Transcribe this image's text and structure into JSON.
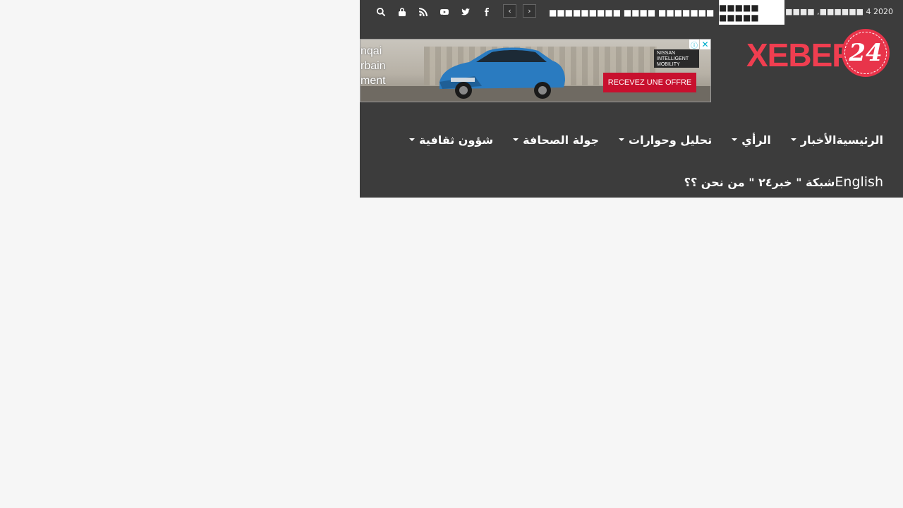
{
  "topbar": {
    "date": "2020 4 ■■■■■■, ■■■■■■",
    "breaking_label": "■■■■■ ■■■■■",
    "ticker_text": "■■■■■■■■■ ■■■■ ■■■■■■■■■■ ■■■■■■ ■...",
    "prev_symbol": "‹",
    "next_symbol": "›",
    "social_icons": [
      "search-icon",
      "lock-icon",
      "rss-icon",
      "youtube-icon",
      "twitter-icon",
      "facebook-icon"
    ]
  },
  "logo": {
    "text": "XEBER",
    "number": "24",
    "color": "#f03e50"
  },
  "ad": {
    "text_lines": [
      "nqai",
      "rbain",
      "ment"
    ],
    "brand_lines": [
      "NISSAN",
      "INTELLIGENT",
      "MOBILITY"
    ],
    "cta": "RECEVEZ UNE OFFRE",
    "info_symbol": "ⓘ",
    "close_symbol": "✕"
  },
  "nav": {
    "row1": [
      {
        "label": "الرئيسية",
        "dropdown": false
      },
      {
        "label": "الأخبار",
        "dropdown": true
      },
      {
        "label": "الرأي",
        "dropdown": true
      },
      {
        "label": "تحليل وحوارات",
        "dropdown": true
      },
      {
        "label": "جولة الصحافة",
        "dropdown": true
      },
      {
        "label": "شؤون ثقافية",
        "dropdown": true
      }
    ],
    "row2": [
      {
        "label": "English"
      },
      {
        "label": "شبكة \" خبر٢٤ \" من نحن ؟؟"
      }
    ]
  },
  "colors": {
    "header_bg": "#3c3c3c",
    "page_bg": "#f6f6f6",
    "accent": "#f03e50"
  }
}
